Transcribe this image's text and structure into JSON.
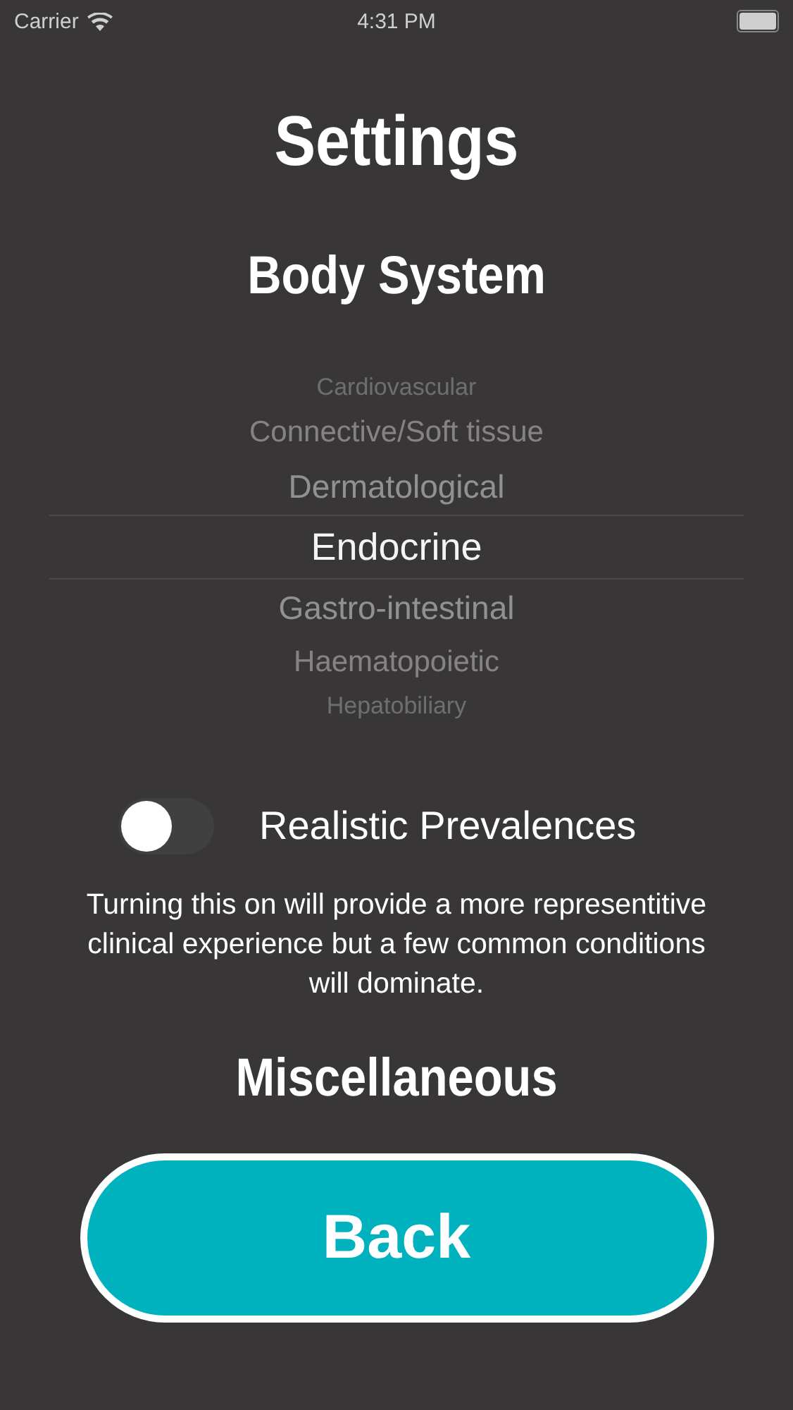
{
  "status_bar": {
    "carrier": "Carrier",
    "time": "4:31 PM"
  },
  "title": "Settings",
  "body_system": {
    "heading": "Body System",
    "options": [
      {
        "label": "Cardiovascular",
        "selected": false
      },
      {
        "label": "Connective/Soft tissue",
        "selected": false
      },
      {
        "label": "Dermatological",
        "selected": false
      },
      {
        "label": "Endocrine",
        "selected": true
      },
      {
        "label": "Gastro-intestinal",
        "selected": false
      },
      {
        "label": "Haematopoietic",
        "selected": false
      },
      {
        "label": "Hepatobiliary",
        "selected": false
      }
    ]
  },
  "realistic_prevalences": {
    "label": "Realistic Prevalences",
    "on": false,
    "description": "Turning this on will provide a more representitive clinical experience but a few common conditions will dominate."
  },
  "miscellaneous": {
    "heading": "Miscellaneous"
  },
  "back_button": "Back"
}
